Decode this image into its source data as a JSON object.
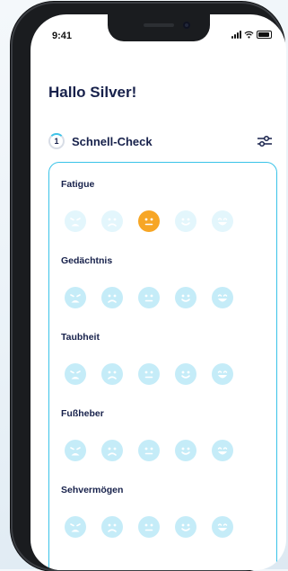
{
  "status_bar": {
    "time": "9:41"
  },
  "greeting": "Hallo Silver!",
  "section": {
    "step": "1",
    "title": "Schnell-Check"
  },
  "icons": {
    "filter": "sliders-icon",
    "faces": [
      "very-sad-face-icon",
      "sad-face-icon",
      "neutral-face-icon",
      "happy-face-icon",
      "very-happy-face-icon"
    ]
  },
  "colors": {
    "face_default": "#c5ecf8",
    "face_faded": "#e3f6fc",
    "face_selected": "#f7a625",
    "card_border": "#39c3e8",
    "title": "#17214b"
  },
  "categories": [
    {
      "label": "Fatigue",
      "selected": 2
    },
    {
      "label": "Gedächtnis",
      "selected": null
    },
    {
      "label": "Taubheit",
      "selected": null
    },
    {
      "label": "Fußheber",
      "selected": null
    },
    {
      "label": "Sehvermögen",
      "selected": null
    }
  ]
}
